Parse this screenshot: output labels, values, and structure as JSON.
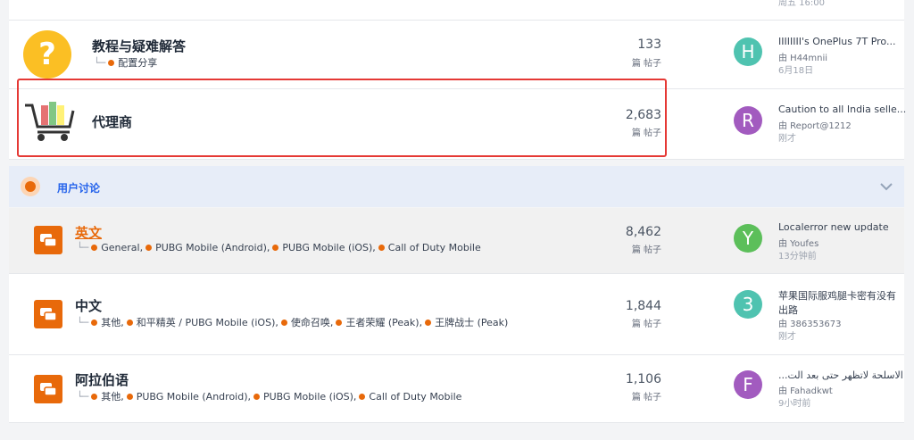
{
  "top": {
    "time": "周五 16:00"
  },
  "rows": [
    {
      "title": "教程与疑难解答",
      "subs": [
        "配置分享"
      ],
      "count": "133",
      "unit": "篇 帖子",
      "last": {
        "avatar": "H",
        "color": "#4fc3b0",
        "title": "IIIIIIII's OnePlus 7T Pro...",
        "by": "由 H44mnii",
        "time": "6月18日"
      }
    },
    {
      "title": "代理商",
      "subs": [],
      "count": "2,683",
      "unit": "篇 帖子",
      "last": {
        "avatar": "R",
        "color": "#a25bbf",
        "title": "Caution to all India selle...",
        "by": "由 Report@1212",
        "time": "刚才"
      }
    }
  ],
  "section": {
    "title": "用户讨论"
  },
  "forums": [
    {
      "title": "英文",
      "subs": [
        "General,",
        "PUBG Mobile (Android),",
        "PUBG Mobile (iOS),",
        "Call of Duty Mobile"
      ],
      "count": "8,462",
      "unit": "篇 帖子",
      "last": {
        "avatar": "Y",
        "color": "#5cbf5a",
        "title": "Localerror new update",
        "by": "由 Youfes",
        "time": "13分钟前"
      }
    },
    {
      "title": "中文",
      "subs": [
        "其他,",
        "和平精英 / PUBG Mobile (iOS),",
        "使命召唤,",
        "王者荣耀 (Peak),",
        "王牌战士 (Peak)"
      ],
      "count": "1,844",
      "unit": "篇 帖子",
      "last": {
        "avatar": "3",
        "color": "#4fc3b0",
        "title": "苹果国际服鸡腿卡密有没有",
        "title2": "出路",
        "by": "由 386353673",
        "time": "刚才"
      }
    },
    {
      "title": "阿拉伯语",
      "subs": [
        "其他,",
        "PUBG Mobile (Android),",
        "PUBG Mobile (iOS),",
        "Call of Duty Mobile"
      ],
      "count": "1,106",
      "unit": "篇 帖子",
      "last": {
        "avatar": "F",
        "color": "#a25bbf",
        "title": "...الاسلحة لاتظهر حتى بعد الت",
        "by": "由 Fahadkwt",
        "time": "9小时前"
      }
    }
  ],
  "colors": {
    "accent": "#e8690a",
    "highlight": "#e53935",
    "section_bg": "#e7edf8"
  }
}
